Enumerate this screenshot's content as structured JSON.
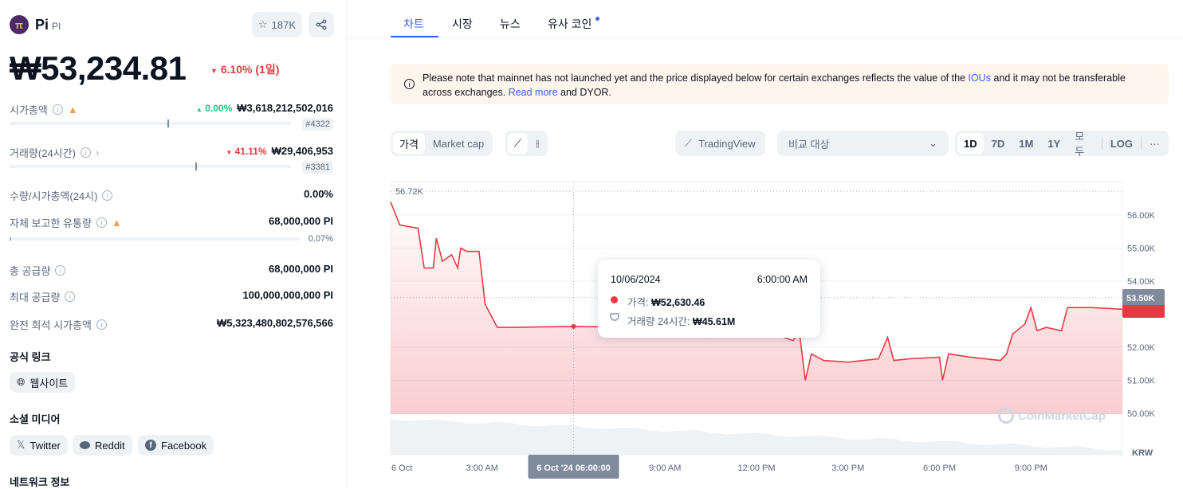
{
  "coin": {
    "name": "Pi",
    "symbol": "PI",
    "watchlist_count": "187K",
    "price": "₩53,234.81",
    "change": "6.10% (1일)",
    "change_color": "#ea3943"
  },
  "stats": [
    {
      "label": "시가총액",
      "change": "0.00%",
      "change_dir": "up",
      "value": "₩3,618,212,502,016",
      "rank": "#4322",
      "bar": 0.56
    },
    {
      "label": "거래량(24시간)",
      "change": "41.11%",
      "change_dir": "down",
      "value": "₩29,406,953",
      "rank": "#3381",
      "bar": 0.66
    },
    {
      "label": "수량/시가총액(24시)",
      "value": "0.00%"
    },
    {
      "label": "자체 보고한 유통량",
      "value": "68,000,000 PI",
      "pct": "0.07%",
      "bar": 0.0007
    },
    {
      "label": "총 공급량",
      "value": "68,000,000 PI"
    },
    {
      "label": "최대 공급량",
      "value": "100,000,000,000 PI"
    },
    {
      "label": "완전 희석 시가총액",
      "value": "₩5,323,480,802,576,566"
    }
  ],
  "links": {
    "official_title": "공식 링크",
    "website": "웹사이트",
    "social_title": "소셜 미디어",
    "twitter": "Twitter",
    "reddit": "Reddit",
    "facebook": "Facebook",
    "network_title": "네트워크 정보"
  },
  "tabs": [
    "차트",
    "시장",
    "뉴스",
    "유사 코인"
  ],
  "notice": {
    "text1": "Please note that mainnet has not launched yet and the price displayed below for certain exchanges reflects the value of the ",
    "ious": "IOUs",
    "text2": " and it may not be transferable across exchanges. ",
    "read_more": "Read more",
    "text3": " and DYOR."
  },
  "toolbar": {
    "price": "가격",
    "market_cap": "Market cap",
    "tradingview": "TradingView",
    "compare": "비교 대상",
    "ranges": [
      "1D",
      "7D",
      "1M",
      "1Y",
      "모두"
    ],
    "log": "LOG",
    "more": "···"
  },
  "tooltip": {
    "date": "10/06/2024",
    "time": "6:00:00 AM",
    "price_label": "가격:",
    "price": "₩52,630.46",
    "volume_label": "거래량 24시간:",
    "volume": "₩45.61M"
  },
  "chart_data": {
    "type": "line",
    "currency": "KRW",
    "watermark": "CoinMarketCap",
    "line_color": "#ea3943",
    "x_ticks": [
      "6 Oct",
      "3:00 AM",
      "9:00 AM",
      "12:00 PM",
      "3:00 PM",
      "6:00 PM",
      "9:00 PM"
    ],
    "x_tick_hours": [
      0,
      3,
      9,
      12,
      15,
      18,
      21
    ],
    "crosshair_label": "6 Oct '24 06:00:00",
    "crosshair_hour": 6,
    "y_ticks": [
      "56.00K",
      "55.00K",
      "54.00K",
      "52.00K",
      "51.00K",
      "50.00K"
    ],
    "y_tick_values": [
      56000,
      55000,
      54000,
      52000,
      51000,
      50000
    ],
    "ylim": [
      49700,
      57100
    ],
    "high_label": "56.72K",
    "high_value": 56720,
    "last_label": "53.50K",
    "last_value": 53500,
    "hours": [
      0,
      0.3,
      0.9,
      1.1,
      1.4,
      1.5,
      1.7,
      2.0,
      2.2,
      2.3,
      2.5,
      2.9,
      3.1,
      3.5,
      4,
      6,
      8,
      10,
      12,
      13.2,
      13.4,
      13.6,
      13.8,
      14.2,
      15,
      16,
      16.3,
      16.5,
      17,
      18,
      18.1,
      18.3,
      19,
      20,
      20.2,
      20.4,
      20.8,
      21,
      21.2,
      21.5,
      22,
      22.2,
      23,
      24
    ],
    "prices": [
      56400,
      55700,
      55600,
      54400,
      54400,
      55300,
      54600,
      54800,
      54400,
      55000,
      54900,
      54900,
      53300,
      52600,
      52600,
      52630,
      52600,
      52600,
      52600,
      52200,
      52500,
      51000,
      51800,
      51600,
      51550,
      51650,
      52300,
      51600,
      51650,
      51700,
      51000,
      51800,
      51700,
      51600,
      51800,
      52400,
      52700,
      53200,
      52500,
      52600,
      52500,
      53200,
      53200,
      53150
    ]
  }
}
